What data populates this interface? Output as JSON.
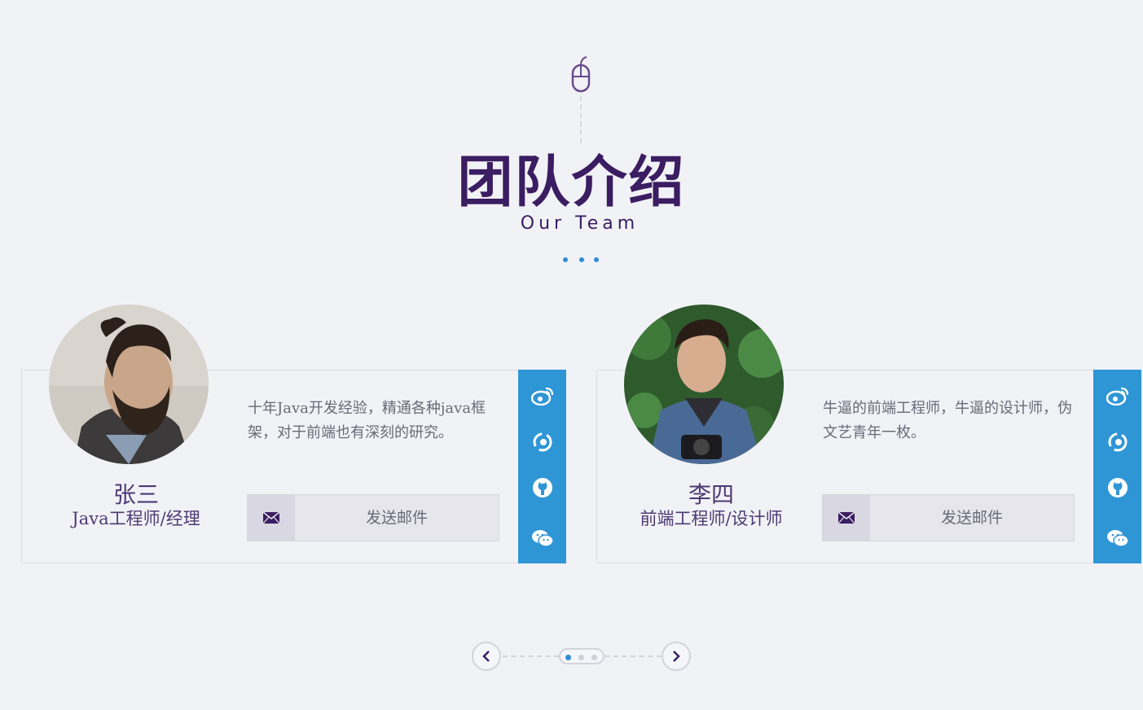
{
  "header": {
    "title": "团队介绍",
    "subtitle": "Our Team"
  },
  "icons": {
    "scroll": "mouse-icon",
    "mail": "envelope-icon",
    "social": [
      "weibo-icon",
      "baidu-icon",
      "github-icon",
      "wechat-icon"
    ],
    "pager_prev": "chevron-left-icon",
    "pager_next": "chevron-right-icon"
  },
  "members": [
    {
      "name": "张三",
      "role": "Java工程师/经理",
      "description": "十年Java开发经验，精通各种java框架，对于前端也有深刻的研究。",
      "mail_label": "发送邮件"
    },
    {
      "name": "李四",
      "role": "前端工程师/设计师",
      "description": "牛逼的前端工程师，牛逼的设计师，伪文艺青年一枚。",
      "mail_label": "发送邮件"
    }
  ],
  "pager": {
    "pages": 3,
    "active_index": 0
  },
  "colors": {
    "background": "#f1f2f6",
    "title": "#3b1d62",
    "accent_blue": "#2f96d6",
    "text_muted": "#6a6a78"
  }
}
